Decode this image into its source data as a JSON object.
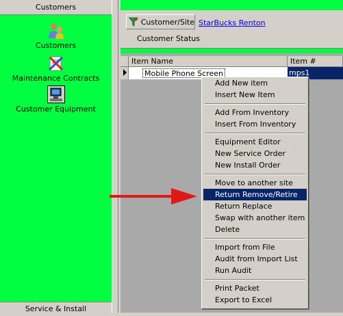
{
  "left_panel": {
    "header": "Customers",
    "items": [
      {
        "label": "Customers",
        "icon": "users-icon"
      },
      {
        "label": "Maintenance Contracts",
        "icon": "contract-tools-icon"
      },
      {
        "label": "Customer Equipment",
        "icon": "computer-equipment-icon"
      }
    ],
    "footer": "Service & Install"
  },
  "toolbar": {
    "customer_site_button": "Customer/Site",
    "customer_site_icon": "funnel-filter-icon",
    "site_link": "StarBucks Renton",
    "status_label": "Customer Status"
  },
  "grid": {
    "columns": [
      "Item Name",
      "Item #"
    ],
    "rows": [
      {
        "item_name": "Mobile Phone Screen",
        "item_number": "mps1"
      }
    ]
  },
  "context_menu": {
    "groups": [
      [
        "Add New item",
        "Insert New Item"
      ],
      [
        "Add From Inventory",
        "Insert From Inventory"
      ],
      [
        "Equipment Editor",
        "New Service Order",
        "New Install Order"
      ],
      [
        "Move to another site",
        "Return Remove/Retire",
        "Return Replace",
        "Swap with another item",
        "Delete"
      ],
      [
        "Import from File",
        "Audit from Import List",
        "Run Audit"
      ],
      [
        "Print Packet",
        "Export to Excel"
      ]
    ],
    "highlighted": "Return Remove/Retire"
  },
  "colors": {
    "nav_green": "#00ff40",
    "menu_highlight": "#0a246a",
    "arrow_red": "#e01818",
    "link_blue": "#0000ee"
  }
}
